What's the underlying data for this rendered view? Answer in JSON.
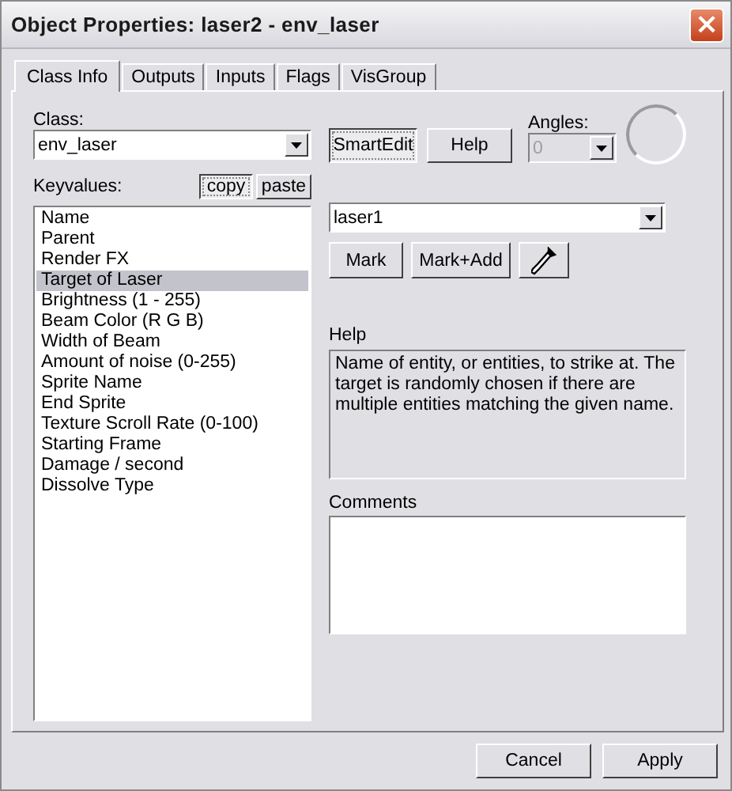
{
  "window": {
    "title": "Object Properties: laser2 - env_laser",
    "close_glyph": "×"
  },
  "tabs": [
    {
      "label": "Class Info",
      "selected": true
    },
    {
      "label": "Outputs",
      "selected": false
    },
    {
      "label": "Inputs",
      "selected": false
    },
    {
      "label": "Flags",
      "selected": false
    },
    {
      "label": "VisGroup",
      "selected": false
    }
  ],
  "class": {
    "label": "Class:",
    "value": "env_laser"
  },
  "smartedit": {
    "label": "SmartEdit",
    "pressed": true
  },
  "help_button": "Help",
  "angles": {
    "label": "Angles:",
    "value": "0",
    "disabled": true
  },
  "keyvalues": {
    "label": "Keyvalues:",
    "buttons": [
      {
        "label": "copy",
        "pressed": true
      },
      {
        "label": "paste",
        "pressed": false
      }
    ],
    "items": [
      {
        "label": "Name",
        "selected": false
      },
      {
        "label": "Parent",
        "selected": false
      },
      {
        "label": "Render FX",
        "selected": false
      },
      {
        "label": "Target of Laser",
        "selected": true
      },
      {
        "label": "Brightness (1 - 255)",
        "selected": false
      },
      {
        "label": "Beam Color (R G B)",
        "selected": false
      },
      {
        "label": "Width of Beam",
        "selected": false
      },
      {
        "label": "Amount of noise (0-255)",
        "selected": false
      },
      {
        "label": "Sprite Name",
        "selected": false
      },
      {
        "label": "End Sprite",
        "selected": false
      },
      {
        "label": "Texture Scroll Rate (0-100)",
        "selected": false
      },
      {
        "label": "Starting Frame",
        "selected": false
      },
      {
        "label": "Damage / second",
        "selected": false
      },
      {
        "label": "Dissolve Type",
        "selected": false
      }
    ]
  },
  "value_field": {
    "value": "laser1"
  },
  "value_buttons": [
    "Mark",
    "Mark+Add"
  ],
  "help": {
    "label": "Help",
    "text": "Name of entity, or entities, to strike at. The target is randomly chosen if there are multiple entities matching the given name."
  },
  "comments": {
    "label": "Comments"
  },
  "footer_buttons": [
    "Cancel",
    "Apply"
  ]
}
